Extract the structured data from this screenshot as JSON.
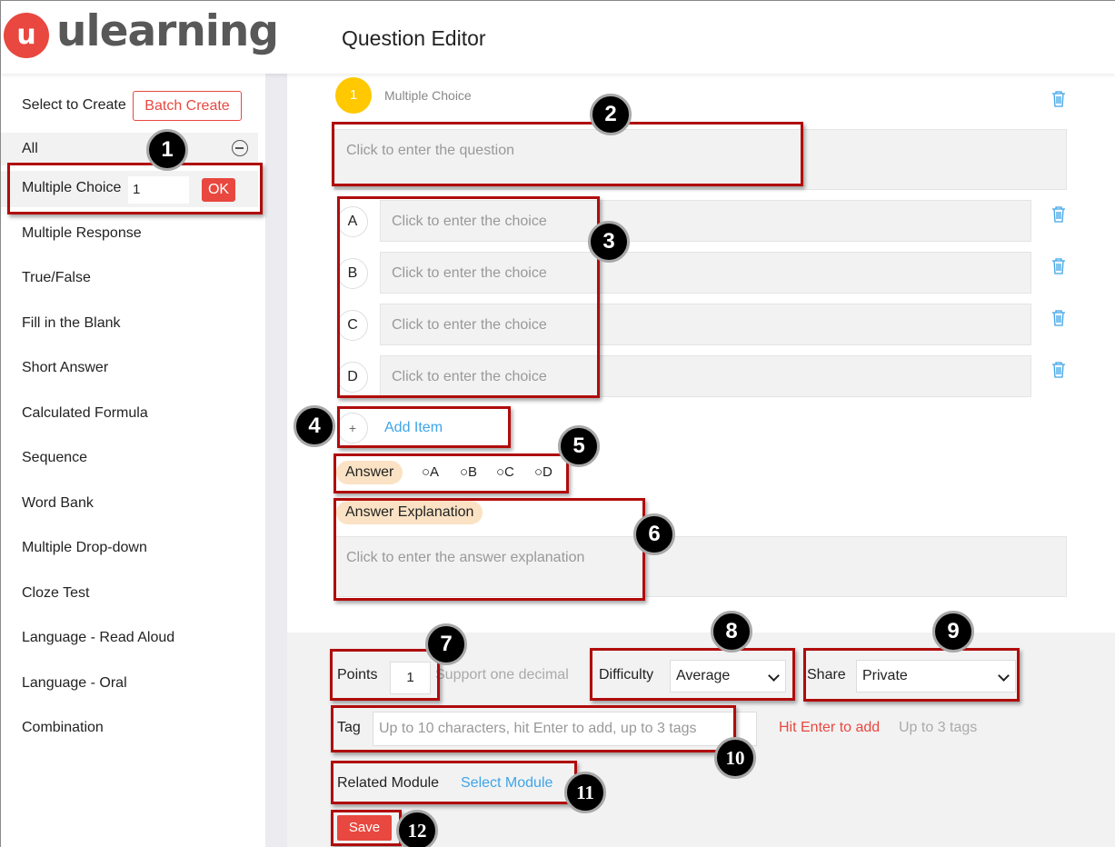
{
  "app": {
    "logo_mark": "u",
    "logo_text": "ulearning",
    "page_title": "Question Editor"
  },
  "sidebar": {
    "select_to_create": "Select to Create",
    "batch_create": "Batch Create",
    "all_label": "All",
    "selected_type": {
      "label": "Multiple Choice",
      "count": "1",
      "ok": "OK"
    },
    "types": [
      "Multiple Response",
      "True/False",
      "Fill in the Blank",
      "Short Answer",
      "Calculated Formula",
      "Sequence",
      "Word Bank",
      "Multiple Drop-down",
      "Cloze Test",
      "Language - Read Aloud",
      "Language - Oral",
      "Combination"
    ]
  },
  "question": {
    "number": "1",
    "type": "Multiple Choice",
    "placeholder": "Click to enter the question",
    "choices": [
      {
        "letter": "A",
        "placeholder": "Click to enter the choice"
      },
      {
        "letter": "B",
        "placeholder": "Click to enter the choice"
      },
      {
        "letter": "C",
        "placeholder": "Click to enter the choice"
      },
      {
        "letter": "D",
        "placeholder": "Click to enter the choice"
      }
    ],
    "add_item_symbol": "+",
    "add_item": "Add Item",
    "answer_label": "Answer",
    "answer_options": [
      "○A",
      "○B",
      "○C",
      "○D"
    ],
    "explanation_label": "Answer Explanation",
    "explanation_placeholder": "Click to enter the answer explanation"
  },
  "settings": {
    "points_label": "Points",
    "points_value": "1",
    "points_hint": "Support one decimal",
    "difficulty_label": "Difficulty",
    "difficulty_value": "Average",
    "share_label": "Share",
    "share_value": "Private",
    "tag_label": "Tag",
    "tag_placeholder": "Up to 10 characters, hit Enter to add, up to 3 tags",
    "tag_hint_red": "Hit Enter to add",
    "tag_hint_grey": "Up to 3 tags",
    "related_module_label": "Related Module",
    "select_module": "Select Module",
    "save": "Save"
  },
  "annotations": [
    "1",
    "2",
    "3",
    "4",
    "5",
    "6",
    "7",
    "8",
    "9",
    "10",
    "11",
    "12"
  ],
  "colors": {
    "brand_red": "#e8483f",
    "link_blue": "#3fa4e8",
    "badge_yellow": "#ffc800",
    "pill_bg": "#fbe2c4",
    "highlight_red": "#b00c0c"
  }
}
